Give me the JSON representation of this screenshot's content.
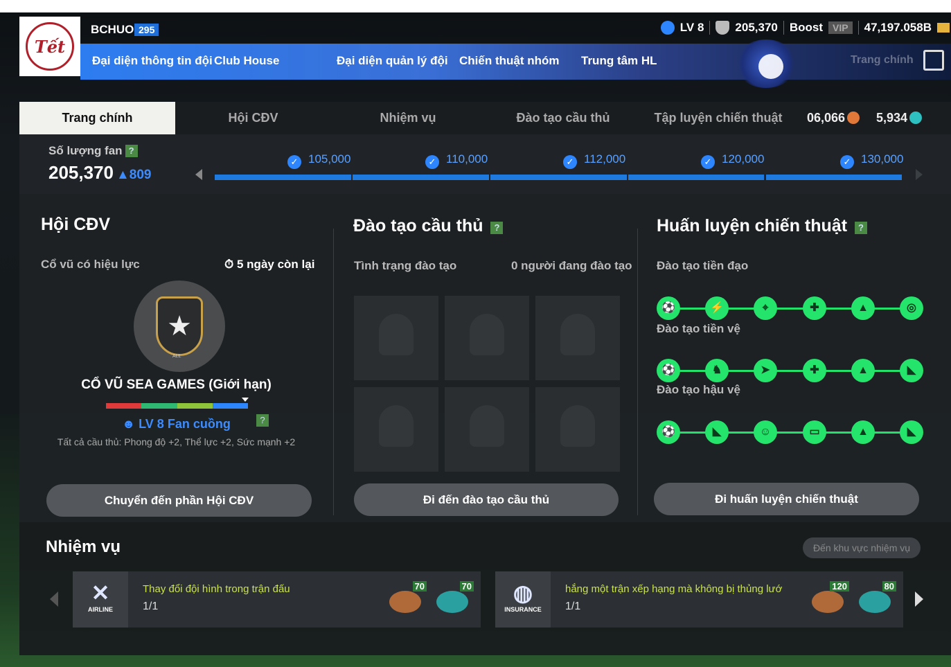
{
  "header": {
    "username": "BCHUOI",
    "user_level": "295",
    "level": "LV 8",
    "fans": "205,370",
    "boost_label": "Boost",
    "vip_label": "VIP",
    "bp": "47,197.058B"
  },
  "nav": {
    "items": [
      "Đại diện thông tin đội",
      "Club House",
      "Đại diện quản lý đội",
      "Chiến thuật nhóm",
      "Trung tâm HL"
    ],
    "main": "Trang chính"
  },
  "tabs": {
    "items": [
      "Trang chính",
      "Hội CĐV",
      "Nhiệm vụ",
      "Đào tạo cầu thủ",
      "Tập luyện chiến thuật"
    ],
    "sc": "06,066",
    "tc": "5,934"
  },
  "fan": {
    "label": "Số lượng fan",
    "help": "?",
    "value": "205,370",
    "delta": "809",
    "milestones": [
      "105,000",
      "110,000",
      "112,000",
      "120,000",
      "130,000"
    ]
  },
  "club": {
    "title": "Hội CĐV",
    "sub": "Cổ vũ có hiệu lực",
    "remaining": "5 ngày còn lại",
    "emblem_text": "ALL",
    "cheer_title": "CỔ VŨ SEA GAMES (Giới hạn)",
    "help": "?",
    "lv": "LV 8 Fan cuồng",
    "bonus": "Tất cả cầu thủ: Phong độ +2, Thể lực +2, Sức mạnh +2",
    "button": "Chuyển đến phần Hội CĐV"
  },
  "training": {
    "title": "Đào tạo cầu thủ",
    "help": "?",
    "status_label": "Tình trạng đào tạo",
    "status_value": "0 người đang đào tạo",
    "button": "Đi đến đào tạo cầu thủ"
  },
  "tactics": {
    "title": "Huấn luyện chiến thuật",
    "help": "?",
    "rows": [
      "Đào tạo tiền đạo",
      "Đào tạo tiền vệ",
      "Đào tạo hậu vệ"
    ],
    "button": "Đi huấn luyện chiến thuật"
  },
  "missions": {
    "title": "Nhiệm vụ",
    "go_button": "Đến khu vực nhiệm vụ",
    "cards": [
      {
        "sponsor": "AIRLINE",
        "text": "Thay đổi đội hình trong trận đấu",
        "progress": "1/1",
        "sc": "70",
        "tc": "70"
      },
      {
        "sponsor": "INSURANCE",
        "text": "hắng một trận xếp hạng mà không bị thủng lướ",
        "progress": "1/1",
        "sc": "120",
        "tc": "80"
      }
    ]
  },
  "colors": {
    "accent": "#2e86ff",
    "tactic_green": "#25e46b",
    "mission_text": "#cbe34a"
  }
}
